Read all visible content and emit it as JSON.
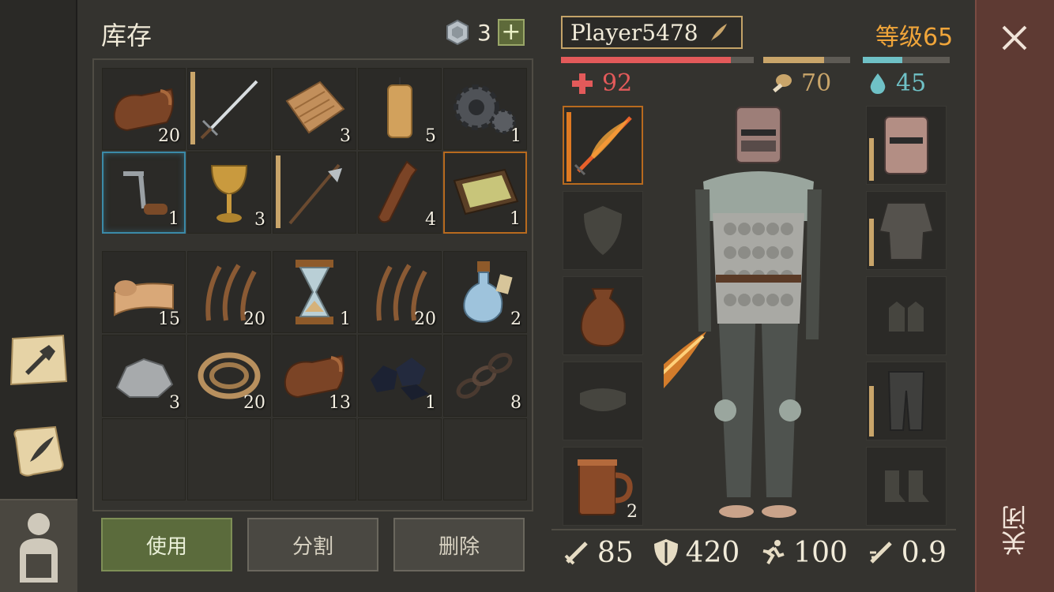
{
  "inventory": {
    "title": "库存",
    "coins": "3",
    "add_label": "+",
    "items_top": [
      {
        "icon": "leather-icon",
        "qty": "20"
      },
      {
        "icon": "sword-icon",
        "qty": ""
      },
      {
        "icon": "cloth-icon",
        "qty": "3"
      },
      {
        "icon": "candle-icon",
        "qty": "5"
      },
      {
        "icon": "gear-icon",
        "qty": "1"
      },
      {
        "icon": "crank-icon",
        "qty": "1"
      },
      {
        "icon": "goblet-icon",
        "qty": "3"
      },
      {
        "icon": "halberd-icon",
        "qty": ""
      },
      {
        "icon": "bottle-icon",
        "qty": "4"
      },
      {
        "icon": "tray-icon",
        "qty": "1"
      }
    ],
    "items_bottom": [
      {
        "icon": "fabric-roll-icon",
        "qty": "15"
      },
      {
        "icon": "fiber-icon",
        "qty": "20"
      },
      {
        "icon": "hourglass-icon",
        "qty": "1"
      },
      {
        "icon": "fiber-icon",
        "qty": "20"
      },
      {
        "icon": "potion-icon",
        "qty": "2"
      },
      {
        "icon": "stone-icon",
        "qty": "3"
      },
      {
        "icon": "rope-icon",
        "qty": "20"
      },
      {
        "icon": "leather-icon",
        "qty": "13"
      },
      {
        "icon": "coal-icon",
        "qty": "1"
      },
      {
        "icon": "chain-icon",
        "qty": "8"
      }
    ],
    "actions": {
      "use": "使用",
      "split": "分割",
      "delete": "删除"
    }
  },
  "character": {
    "name": "Player5478",
    "level_label": "等级",
    "level": "65",
    "health": "92",
    "food": "70",
    "water": "45",
    "health_fraction": 0.88,
    "food_fraction": 0.7,
    "water_fraction": 0.45,
    "mug_qty": "2",
    "attack": "85",
    "armor": "420",
    "speed": "100",
    "attack_speed": "0.9"
  },
  "close_label": "关闭",
  "colors": {
    "health": "#e35a5a",
    "food": "#c9a56a",
    "water": "#6fc1c6",
    "level": "#f0a53a"
  }
}
